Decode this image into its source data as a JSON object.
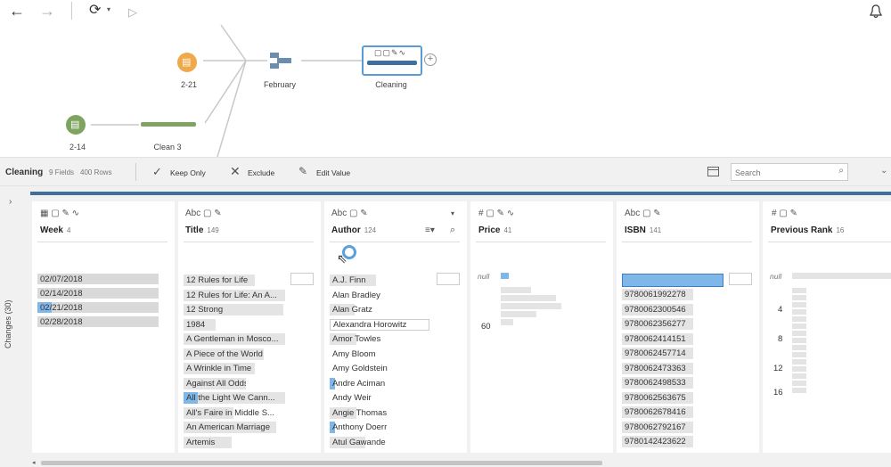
{
  "toolbar": {
    "back": "←",
    "forward": "→",
    "refresh": "⟳",
    "play": "▷",
    "bell": "🔔"
  },
  "flow": {
    "nodes": [
      {
        "label": "2-21"
      },
      {
        "label": "February"
      },
      {
        "label": "Cleaning"
      },
      {
        "label": "2-14"
      },
      {
        "label": "Clean 3"
      }
    ]
  },
  "header": {
    "step_name": "Cleaning",
    "fields": "9 Fields",
    "rows": "400 Rows",
    "keep_only": "Keep Only",
    "exclude": "Exclude",
    "edit_value": "Edit Value",
    "search_placeholder": "Search"
  },
  "sidebar": {
    "changes": "Changes (30)"
  },
  "columns": [
    {
      "type": "date",
      "name": "Week",
      "count": "4",
      "values": [
        "02/07/2018",
        "02/14/2018",
        "02/21/2018",
        "02/28/2018"
      ]
    },
    {
      "type": "Abc",
      "name": "Title",
      "count": "149",
      "values": [
        "12 Rules for Life",
        "12 Rules for Life: An A...",
        "12 Strong",
        "1984",
        "A Gentleman in Mosco...",
        "A Piece of the World",
        "A Wrinkle in Time",
        "Against All Odds",
        "All the Light We Cann...",
        "All's Faire in Middle S...",
        "An American Marriage",
        "Artemis"
      ]
    },
    {
      "type": "Abc",
      "name": "Author",
      "count": "124",
      "values": [
        "A.J. Finn",
        "Alan Bradley",
        "Alan Gratz",
        "Alexandra Horowitz",
        "Amor Towles",
        "Amy Bloom",
        "Amy Goldstein",
        "Andre Aciman",
        "Andy Weir",
        "Angie Thomas",
        "Anthony Doerr",
        "Atul Gawande"
      ]
    },
    {
      "type": "#",
      "name": "Price",
      "count": "41",
      "ticks": [
        "null",
        "60"
      ]
    },
    {
      "type": "Abc",
      "name": "ISBN",
      "count": "141",
      "values": [
        "",
        "9780061992278",
        "9780062300546",
        "9780062356277",
        "9780062414151",
        "9780062457714",
        "9780062473363",
        "9780062498533",
        "9780062563675",
        "9780062678416",
        "9780062792167",
        "9780142423622"
      ]
    },
    {
      "type": "#",
      "name": "Previous Rank",
      "count": "16",
      "ticks": [
        "null",
        "4",
        "8",
        "12",
        "16"
      ]
    }
  ]
}
